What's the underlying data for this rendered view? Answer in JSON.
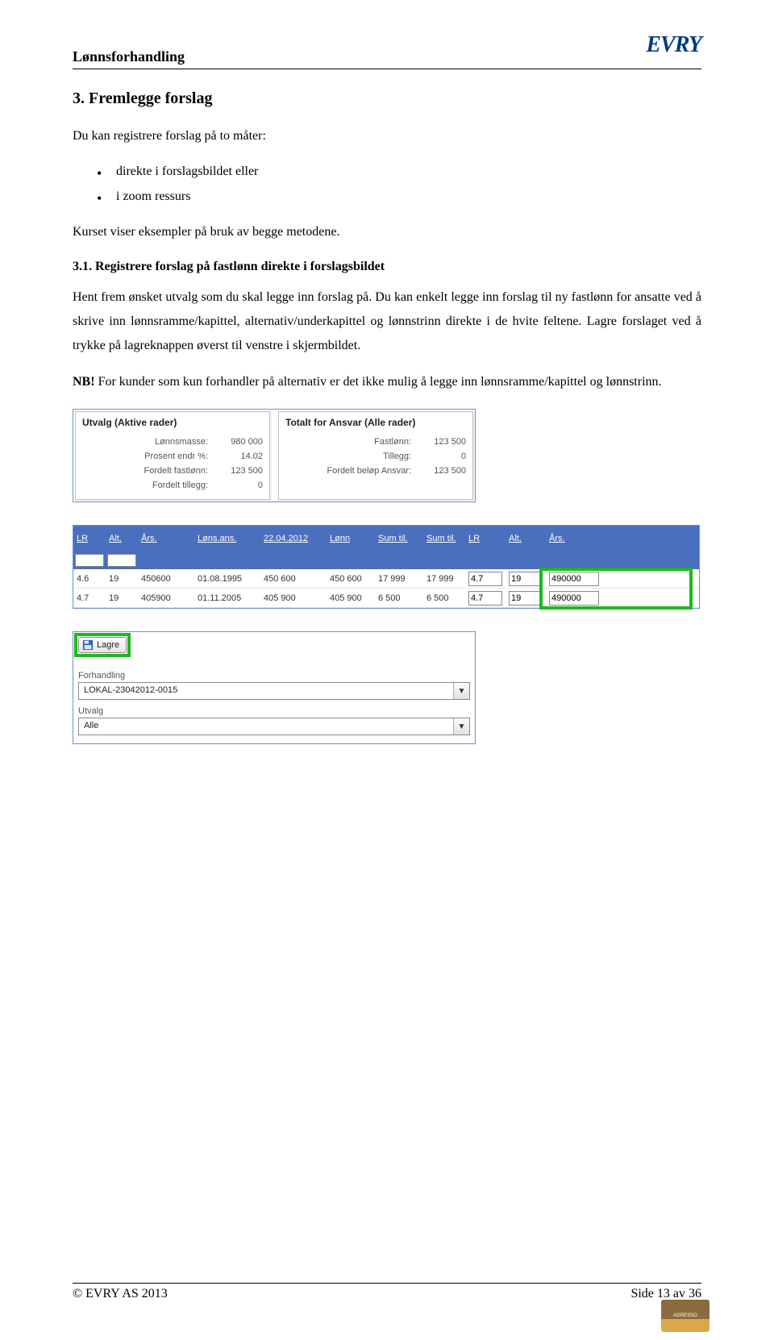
{
  "header": {
    "title": "Lønnsforhandling",
    "logo": "EVRY"
  },
  "h1": "3.   Fremlegge forslag",
  "intro": "Du kan registrere forslag på to måter:",
  "bullets": [
    "direkte i forslagsbildet eller",
    "i zoom ressurs"
  ],
  "intro2": "Kurset viser eksempler på bruk av begge metodene.",
  "h2": "3.1. Registrere forslag på fastlønn direkte i forslagsbildet",
  "body1": "Hent frem ønsket utvalg som du skal legge inn forslag på. Du kan enkelt legge inn forslag til ny fastlønn for ansatte ved å skrive inn lønnsramme/kapittel, alternativ/underkapittel og lønnstrinn direkte i de hvite feltene. Lagre forslaget ved å trykke på lagreknappen øverst til venstre i skjermbildet.",
  "body2_label": "NB!",
  "body2": " For kunder som kun forhandler på alternativ er det ikke mulig å legge inn lønnsramme/kapittel og lønnstrinn.",
  "panels": {
    "left": {
      "title": "Utvalg (Aktive rader)",
      "rows": [
        {
          "lbl": "Lønnsmasse:",
          "val": "980 000"
        },
        {
          "lbl": "Prosent endr %:",
          "val": "14.02"
        },
        {
          "lbl": "Fordelt fastlønn:",
          "val": "123 500"
        },
        {
          "lbl": "Fordelt tillegg:",
          "val": "0"
        }
      ]
    },
    "right": {
      "title": "Totalt for Ansvar (Alle rader)",
      "rows": [
        {
          "lbl": "Fastlønn:",
          "val": "123 500"
        },
        {
          "lbl": "Tillegg:",
          "val": "0"
        },
        {
          "lbl": "Fordelt beløp Ansvar:",
          "val": "123 500"
        }
      ]
    }
  },
  "table": {
    "headers": [
      "LR",
      "Alt.",
      "Års.",
      "Løns.ans.",
      "22.04.2012",
      "Lønn",
      "Sum til.",
      "Sum til.",
      "LR",
      "Alt.",
      "Års."
    ],
    "rows": [
      {
        "c": [
          "4.6",
          "19",
          "450600",
          "01.08.1995",
          "450 600",
          "450 600",
          "17 999",
          "17 999"
        ],
        "inputs": [
          "4.7",
          "19",
          "490000"
        ]
      },
      {
        "c": [
          "4.7",
          "19",
          "405900",
          "01.11.2005",
          "405 900",
          "405 900",
          "6 500",
          "6 500"
        ],
        "inputs": [
          "4.7",
          "19",
          "490000"
        ]
      }
    ]
  },
  "form": {
    "save_label": "Lagre",
    "forhandling_label": "Forhandling",
    "forhandling_value": "LOKAL-23042012-0015",
    "utvalg_label": "Utvalg",
    "utvalg_value": "Alle"
  },
  "footer": {
    "left": "© EVRY AS 2013",
    "right": "Side 13 av 36",
    "badge": "AGRESSO"
  }
}
